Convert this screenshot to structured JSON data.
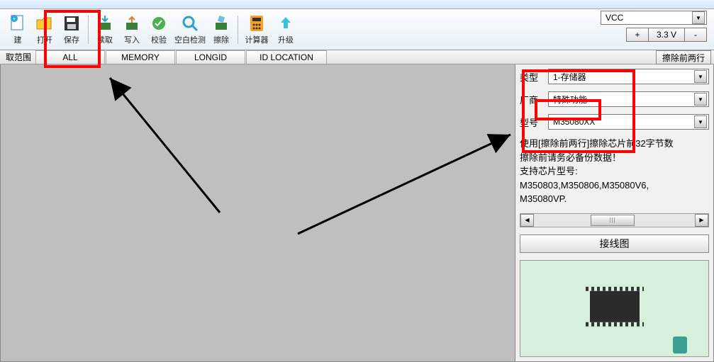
{
  "toolbar": {
    "items": [
      {
        "name": "new",
        "label": "建"
      },
      {
        "name": "open",
        "label": "打开"
      },
      {
        "name": "save",
        "label": "保存"
      },
      {
        "name": "read",
        "label": "读取"
      },
      {
        "name": "write",
        "label": "写入"
      },
      {
        "name": "verify",
        "label": "校验"
      },
      {
        "name": "blank",
        "label": "空白检测"
      },
      {
        "name": "erase",
        "label": "擦除"
      },
      {
        "name": "calc",
        "label": "计算器"
      },
      {
        "name": "upgrade",
        "label": "升级"
      }
    ]
  },
  "vcc": {
    "select_label": "VCC",
    "plus": "+",
    "value": "3.3 V",
    "minus": "-"
  },
  "range": {
    "label": "取范围",
    "tabs": [
      "ALL",
      "MEMORY",
      "LONGID",
      "ID LOCATION"
    ],
    "right_btn": "擦除前两行"
  },
  "side": {
    "type_label": "类型",
    "type_value": "1-存储器",
    "vendor_label": "厂商",
    "vendor_value": "特殊功能",
    "model_label": "型号",
    "model_value": "M35080XX",
    "info_l1": "使用[擦除前两行]擦除芯片前32字节数",
    "info_l2": "擦除前请务必备份数据！",
    "info_l3": "支持芯片型号:",
    "info_l4": "M350803,M350806,M35080V6,",
    "info_l5": "M35080VP.",
    "wire_btn": "接线图"
  },
  "colors": {
    "highlight": "#ff0000"
  }
}
